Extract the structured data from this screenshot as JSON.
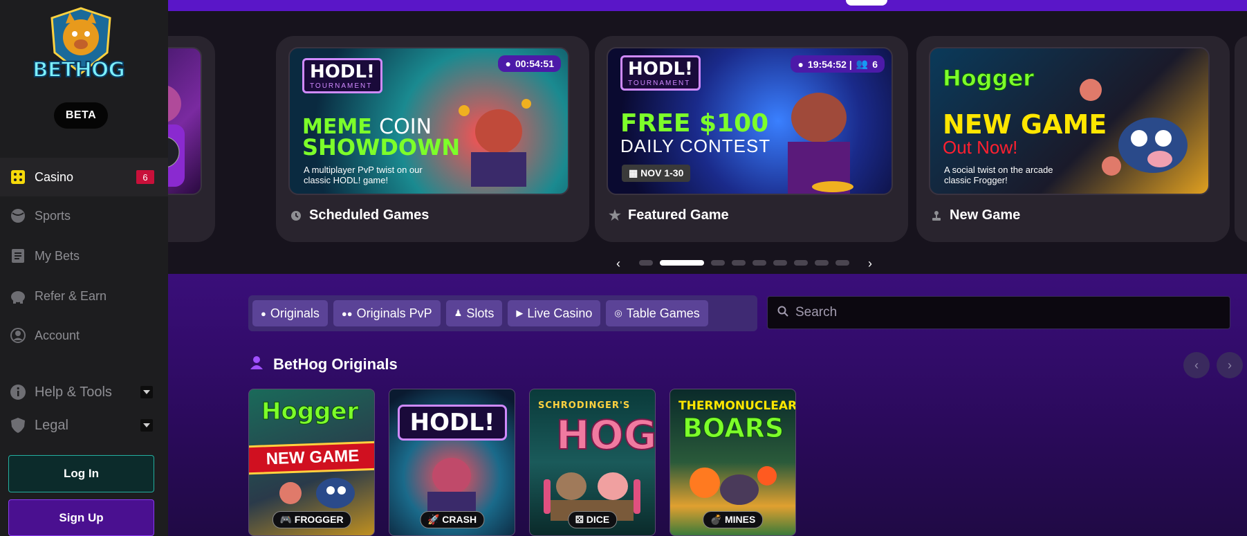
{
  "sidebar": {
    "logo_text": "BETHOG",
    "beta_label": "BETA",
    "items": [
      {
        "label": "Casino",
        "badge": "6"
      },
      {
        "label": "Sports"
      },
      {
        "label": "My Bets"
      },
      {
        "label": "Refer & Earn"
      },
      {
        "label": "Account"
      },
      {
        "label": "Help & Tools"
      },
      {
        "label": "Legal"
      }
    ],
    "login_label": "Log In",
    "signup_label": "Sign Up"
  },
  "carousel": {
    "cards": [
      {
        "label": "Scheduled Games",
        "timer": "00:54:51",
        "badge": "HODL!",
        "badge_sub": "TOURNAMENT",
        "headline1": "MEME",
        "headline1b": "COIN",
        "headline2": "SHOWDOWN",
        "desc": "A multiplayer PvP twist on our classic HODL! game!"
      },
      {
        "label": "Featured Game",
        "timer": "19:54:52 |",
        "players": "6",
        "badge": "HODL!",
        "badge_sub": "TOURNAMENT",
        "headline1": "FREE $100",
        "headline2": "DAILY CONTEST",
        "date": "NOV 1-30"
      },
      {
        "label": "New Game",
        "badge": "Hogger",
        "headline1": "NEW GAME",
        "headline2": "Out Now!",
        "desc": "A social twist on the arcade classic Frogger!"
      }
    ],
    "prev": "‹",
    "next": "›"
  },
  "filters": {
    "tabs": [
      "Originals",
      "Originals PvP",
      "Slots",
      "Live Casino",
      "Table Games"
    ],
    "search_placeholder": "Search"
  },
  "originals": {
    "title": "BetHog Originals",
    "games": [
      {
        "tag": "FROGGER",
        "art1": "Hogger",
        "art2": "NEW GAME"
      },
      {
        "tag": "CRASH",
        "art1": "HODL!"
      },
      {
        "tag": "DICE",
        "art1": "SCHRODINGER'S",
        "art2": "HOG"
      },
      {
        "tag": "MINES",
        "art1": "THERMONUCLEAR",
        "art2": "BOARS"
      }
    ]
  },
  "colors": {
    "accent": "#5a16c8",
    "casino_badge": "#c8103a",
    "login_border": "#24b0a0",
    "signup_bg": "#4a1090"
  }
}
